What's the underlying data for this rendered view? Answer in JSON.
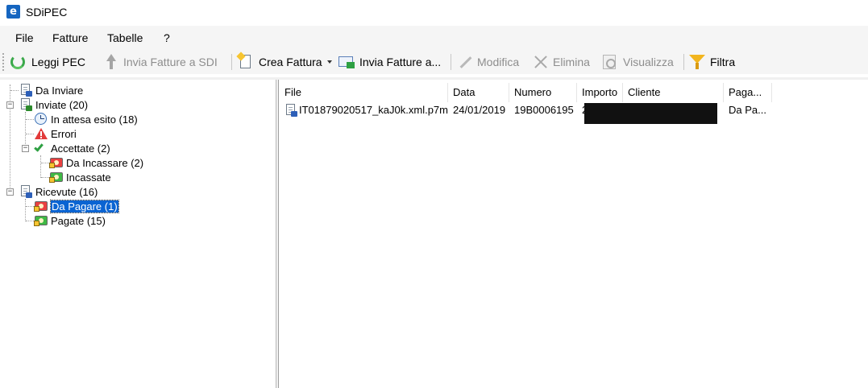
{
  "window": {
    "title": "SDiPEC",
    "app_icon_glyph": "e"
  },
  "menu": {
    "items": [
      "File",
      "Fatture",
      "Tabelle",
      "?"
    ]
  },
  "toolbar": {
    "leggi_pec": "Leggi PEC",
    "invia_fatture_sdi": "Invia Fatture a SDI",
    "crea_fattura": "Crea Fattura",
    "invia_fatture_a": "Invia Fatture a...",
    "modifica": "Modifica",
    "elimina": "Elimina",
    "visualizza": "Visualizza",
    "filtra": "Filtra"
  },
  "tree": {
    "da_inviare": "Da Inviare",
    "inviate": "Inviate (20)",
    "in_attesa": "In attesa esito (18)",
    "errori": "Errori",
    "accettate": "Accettate (2)",
    "da_incassare": "Da Incassare (2)",
    "incassate": "Incassate",
    "ricevute": "Ricevute (16)",
    "da_pagare": "Da Pagare (1)",
    "pagate": "Pagate (15)"
  },
  "list": {
    "columns": [
      "File",
      "Data",
      "Numero",
      "Importo",
      "Cliente",
      "Paga..."
    ],
    "rows": [
      {
        "file": "IT01879020517_kaJ0k.xml.p7m",
        "data": "24/01/2019",
        "numero": "19B0006195",
        "importo": "2",
        "cliente": "",
        "pagamento": "Da Pa..."
      }
    ]
  },
  "colors": {
    "selection": "#0a64d2",
    "menubar_bg": "#f5f5f5"
  }
}
